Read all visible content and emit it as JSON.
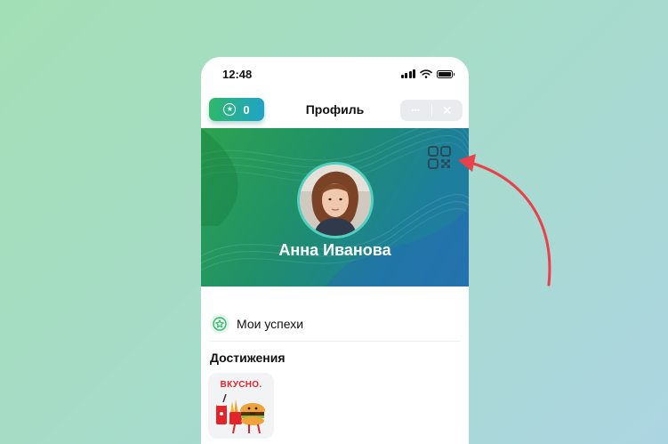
{
  "status_bar": {
    "time": "12:48"
  },
  "header": {
    "points_count": "0",
    "title": "Профиль",
    "more_label": "•••",
    "close_label": "✕"
  },
  "profile": {
    "name": "Анна Иванова"
  },
  "sheet": {
    "achievements_row_label": "Мои успехи",
    "section_title": "Достижения",
    "badge_text": "ВКУСНО."
  },
  "colors": {
    "accent_green": "#2fb86a",
    "accent_blue": "#1fa3c8",
    "arrow_red": "#e8414a"
  },
  "icons": [
    "star-icon",
    "qr-code-icon",
    "more-dots-icon",
    "close-icon",
    "wifi-icon",
    "signal-icon",
    "battery-icon"
  ]
}
